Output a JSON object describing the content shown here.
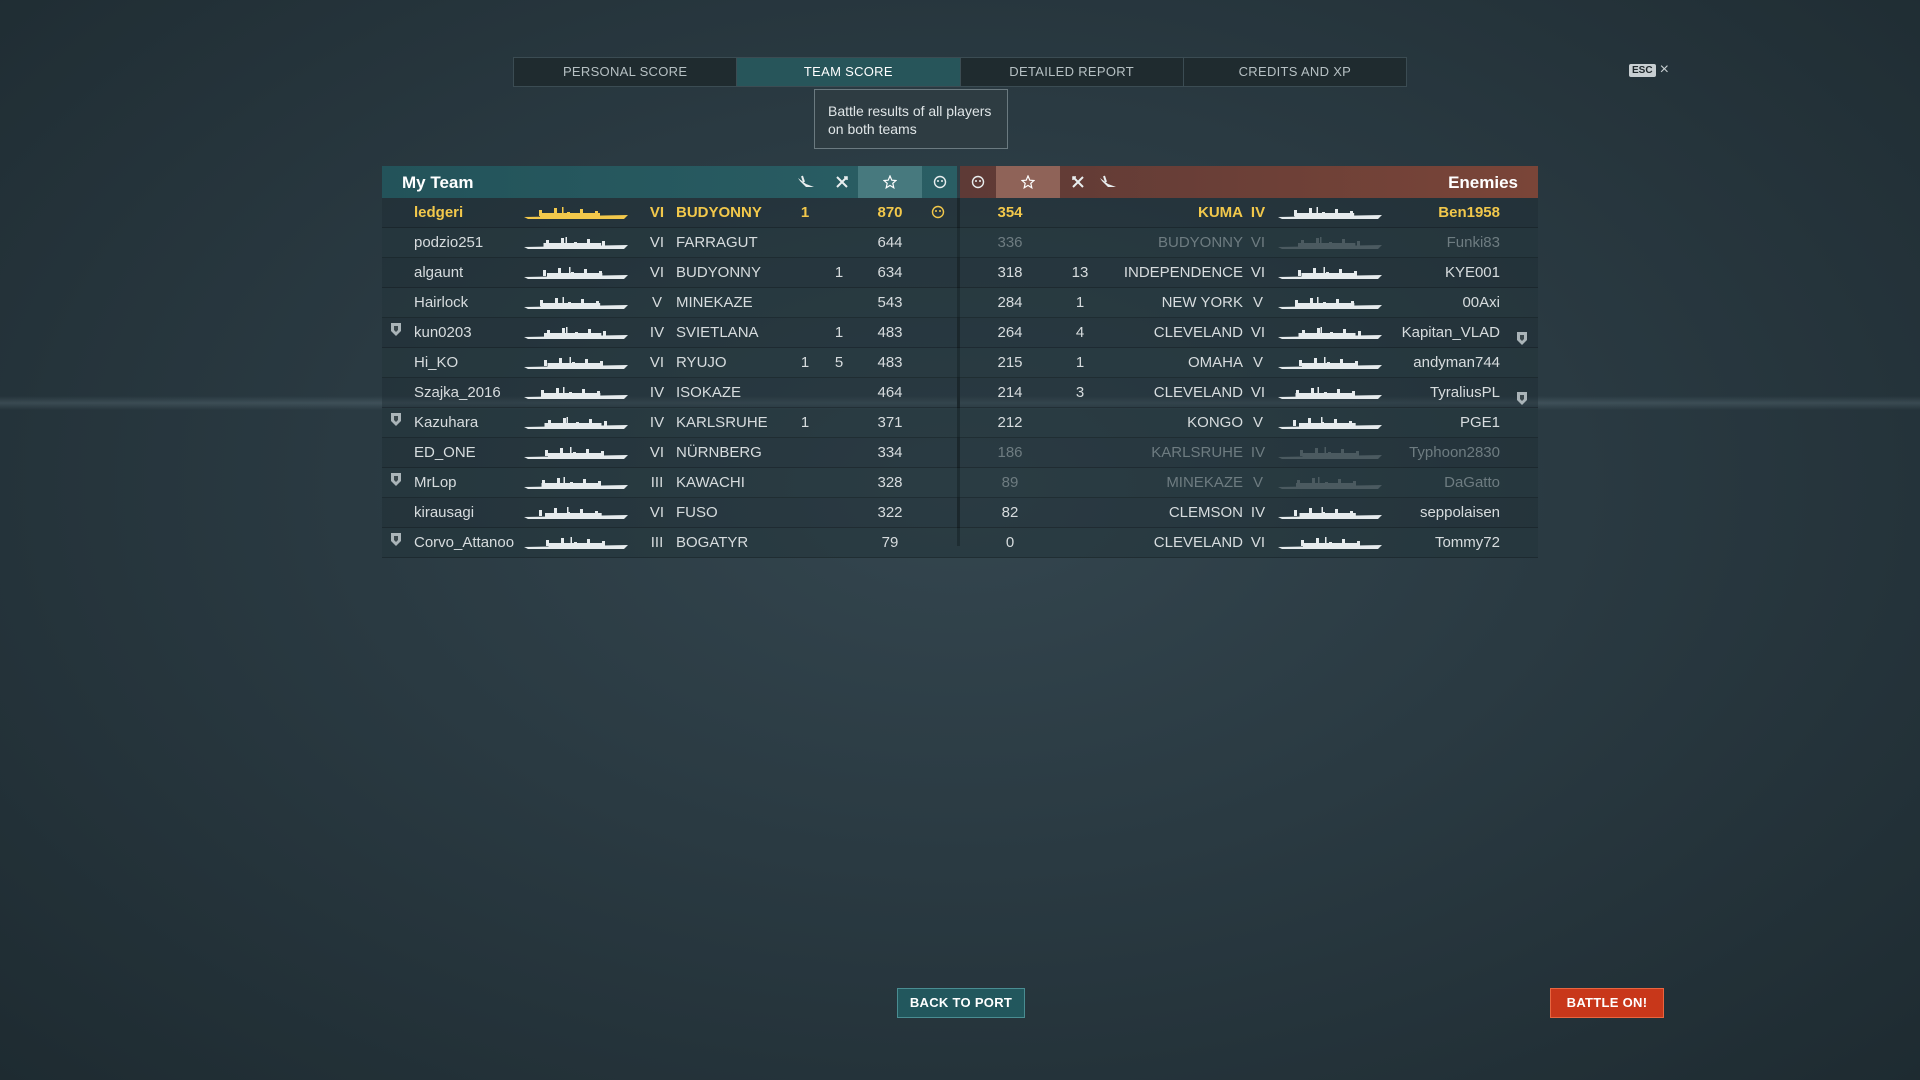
{
  "tabs": [
    "PERSONAL SCORE",
    "TEAM SCORE",
    "DETAILED REPORT",
    "CREDITS AND XP"
  ],
  "active_tab": 1,
  "tooltip": "Battle results of all players on both teams",
  "esc_label": "ESC",
  "close_icon": "×",
  "my_team": {
    "title": "My Team",
    "players": [
      {
        "name": "ledgeri",
        "tier": "VI",
        "ship": "BUDYONNY",
        "c1": "1",
        "c2": "",
        "score": "870",
        "self": true,
        "badge": false,
        "faded": false
      },
      {
        "name": "podzio251",
        "tier": "VI",
        "ship": "FARRAGUT",
        "c1": "",
        "c2": "",
        "score": "644",
        "self": false,
        "badge": false,
        "faded": false
      },
      {
        "name": "algaunt",
        "tier": "VI",
        "ship": "BUDYONNY",
        "c1": "",
        "c2": "1",
        "score": "634",
        "self": false,
        "badge": false,
        "faded": false
      },
      {
        "name": "Hairlock",
        "tier": "V",
        "ship": "MINEKAZE",
        "c1": "",
        "c2": "",
        "score": "543",
        "self": false,
        "badge": false,
        "faded": false
      },
      {
        "name": "kun0203",
        "tier": "IV",
        "ship": "SVIETLANA",
        "c1": "",
        "c2": "1",
        "score": "483",
        "self": false,
        "badge": true,
        "faded": false
      },
      {
        "name": "Hi_KO",
        "tier": "VI",
        "ship": "RYUJO",
        "c1": "1",
        "c2": "5",
        "score": "483",
        "self": false,
        "badge": false,
        "faded": false
      },
      {
        "name": "Szajka_2016",
        "tier": "IV",
        "ship": "ISOKAZE",
        "c1": "",
        "c2": "",
        "score": "464",
        "self": false,
        "badge": false,
        "faded": false
      },
      {
        "name": "Kazuhara",
        "tier": "IV",
        "ship": "KARLSRUHE",
        "c1": "1",
        "c2": "",
        "score": "371",
        "self": false,
        "badge": true,
        "faded": false
      },
      {
        "name": "ED_ONE",
        "tier": "VI",
        "ship": "NÜRNBERG",
        "c1": "",
        "c2": "",
        "score": "334",
        "self": false,
        "badge": false,
        "faded": false
      },
      {
        "name": "MrLop",
        "tier": "III",
        "ship": "KAWACHI",
        "c1": "",
        "c2": "",
        "score": "328",
        "self": false,
        "badge": true,
        "faded": false
      },
      {
        "name": "kirausagi",
        "tier": "VI",
        "ship": "FUSO",
        "c1": "",
        "c2": "",
        "score": "322",
        "self": false,
        "badge": false,
        "faded": false
      },
      {
        "name": "Corvo_Attanoo",
        "tier": "III",
        "ship": "BOGATYR",
        "c1": "",
        "c2": "",
        "score": "79",
        "self": false,
        "badge": true,
        "faded": false
      }
    ]
  },
  "enemies": {
    "title": "Enemies",
    "players": [
      {
        "name": "Ben1958",
        "tier": "IV",
        "ship": "KUMA",
        "c1": "",
        "score": "354",
        "badge": false,
        "faded": false
      },
      {
        "name": "Funki83",
        "tier": "VI",
        "ship": "BUDYONNY",
        "c1": "",
        "score": "336",
        "badge": false,
        "faded": true
      },
      {
        "name": "KYE001",
        "tier": "VI",
        "ship": "INDEPENDENCE",
        "c1": "13",
        "score": "318",
        "badge": false,
        "faded": false
      },
      {
        "name": "00Axi",
        "tier": "V",
        "ship": "NEW YORK",
        "c1": "1",
        "score": "284",
        "badge": false,
        "faded": false
      },
      {
        "name": "Kapitan_VLAD",
        "tier": "VI",
        "ship": "CLEVELAND",
        "c1": "4",
        "score": "264",
        "badge": true,
        "faded": false
      },
      {
        "name": "andyman744",
        "tier": "V",
        "ship": "OMAHA",
        "c1": "1",
        "score": "215",
        "badge": false,
        "faded": false
      },
      {
        "name": "TyraliusPL",
        "tier": "VI",
        "ship": "CLEVELAND",
        "c1": "3",
        "score": "214",
        "badge": true,
        "faded": false
      },
      {
        "name": "PGE1",
        "tier": "V",
        "ship": "KONGO",
        "c1": "",
        "score": "212",
        "badge": false,
        "faded": false
      },
      {
        "name": "Typhoon2830",
        "tier": "IV",
        "ship": "KARLSRUHE",
        "c1": "",
        "score": "186",
        "badge": false,
        "faded": true
      },
      {
        "name": "DaGatto",
        "tier": "V",
        "ship": "MINEKAZE",
        "c1": "",
        "score": "89",
        "badge": false,
        "faded": true
      },
      {
        "name": "seppolaisen",
        "tier": "IV",
        "ship": "CLEMSON",
        "c1": "",
        "score": "82",
        "badge": false,
        "faded": false
      },
      {
        "name": "Tommy72",
        "tier": "VI",
        "ship": "CLEVELAND",
        "c1": "",
        "score": "0",
        "badge": false,
        "faded": false
      }
    ]
  },
  "buttons": {
    "back_to_port": "BACK TO PORT",
    "battle_on": "BATTLE ON!"
  },
  "colors": {
    "self_highlight": "#f2c84b",
    "my_team_header": "#2a5e64",
    "enemy_header": "#7a4538",
    "battle_button": "#c8371a",
    "port_button": "#22575d"
  }
}
